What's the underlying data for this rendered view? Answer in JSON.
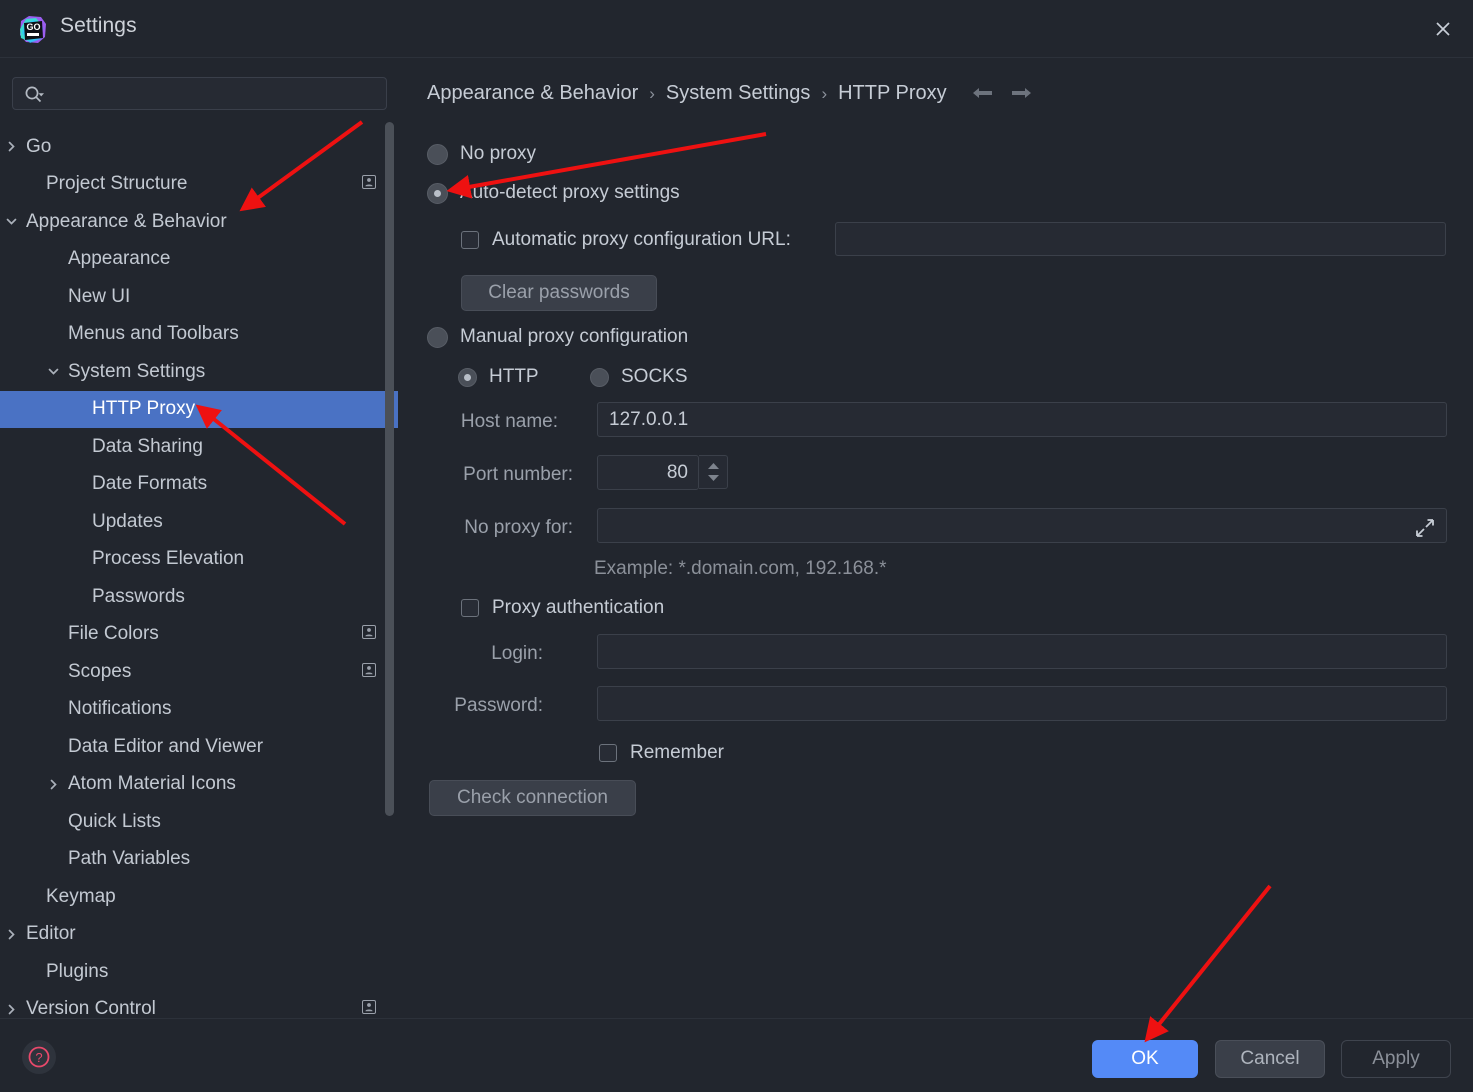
{
  "window": {
    "title": "Settings",
    "logo_icon": "goland-logo-icon",
    "close_icon": "close-icon"
  },
  "sidebar": {
    "search": {
      "placeholder": "",
      "value": "",
      "icon": "search-icon"
    },
    "items": [
      {
        "label": "Go",
        "indent": 26,
        "arrow": "right",
        "badge": false,
        "selected": false
      },
      {
        "label": "Project Structure",
        "indent": 46,
        "arrow": "none",
        "badge": true,
        "selected": false
      },
      {
        "label": "Appearance & Behavior",
        "indent": 26,
        "arrow": "down",
        "badge": false,
        "selected": false
      },
      {
        "label": "Appearance",
        "indent": 68,
        "arrow": "none",
        "badge": false,
        "selected": false
      },
      {
        "label": "New UI",
        "indent": 68,
        "arrow": "none",
        "badge": false,
        "selected": false
      },
      {
        "label": "Menus and Toolbars",
        "indent": 68,
        "arrow": "none",
        "badge": false,
        "selected": false
      },
      {
        "label": "System Settings",
        "indent": 68,
        "arrow": "down",
        "badge": false,
        "selected": false
      },
      {
        "label": "HTTP Proxy",
        "indent": 92,
        "arrow": "none",
        "badge": false,
        "selected": true
      },
      {
        "label": "Data Sharing",
        "indent": 92,
        "arrow": "none",
        "badge": false,
        "selected": false
      },
      {
        "label": "Date Formats",
        "indent": 92,
        "arrow": "none",
        "badge": false,
        "selected": false
      },
      {
        "label": "Updates",
        "indent": 92,
        "arrow": "none",
        "badge": false,
        "selected": false
      },
      {
        "label": "Process Elevation",
        "indent": 92,
        "arrow": "none",
        "badge": false,
        "selected": false
      },
      {
        "label": "Passwords",
        "indent": 92,
        "arrow": "none",
        "badge": false,
        "selected": false
      },
      {
        "label": "File Colors",
        "indent": 68,
        "arrow": "none",
        "badge": true,
        "selected": false
      },
      {
        "label": "Scopes",
        "indent": 68,
        "arrow": "none",
        "badge": true,
        "selected": false
      },
      {
        "label": "Notifications",
        "indent": 68,
        "arrow": "none",
        "badge": false,
        "selected": false
      },
      {
        "label": "Data Editor and Viewer",
        "indent": 68,
        "arrow": "none",
        "badge": false,
        "selected": false
      },
      {
        "label": "Atom Material Icons",
        "indent": 68,
        "arrow": "right",
        "badge": false,
        "selected": false
      },
      {
        "label": "Quick Lists",
        "indent": 68,
        "arrow": "none",
        "badge": false,
        "selected": false
      },
      {
        "label": "Path Variables",
        "indent": 68,
        "arrow": "none",
        "badge": false,
        "selected": false
      },
      {
        "label": "Keymap",
        "indent": 46,
        "arrow": "none",
        "badge": false,
        "selected": false
      },
      {
        "label": "Editor",
        "indent": 26,
        "arrow": "right",
        "badge": false,
        "selected": false
      },
      {
        "label": "Plugins",
        "indent": 46,
        "arrow": "none",
        "badge": false,
        "selected": false
      },
      {
        "label": "Version Control",
        "indent": 26,
        "arrow": "right",
        "badge": true,
        "selected": false
      }
    ]
  },
  "breadcrumb": {
    "parts": [
      "Appearance & Behavior",
      "System Settings",
      "HTTP Proxy"
    ],
    "separator": "›",
    "back_icon": "arrow-left-icon",
    "forward_icon": "arrow-right-icon"
  },
  "main": {
    "no_proxy_label": "No proxy",
    "no_proxy_selected": false,
    "auto_detect_label": "Auto-detect proxy settings",
    "auto_detect_selected": true,
    "pac_url_label": "Automatic proxy configuration URL:",
    "pac_url_checked": false,
    "pac_url_value": "",
    "clear_passwords_label": "Clear passwords",
    "manual_label": "Manual proxy configuration",
    "manual_selected": false,
    "http_label": "HTTP",
    "http_selected": true,
    "socks_label": "SOCKS",
    "socks_selected": false,
    "host_label": "Host name:",
    "host_value": "127.0.0.1",
    "port_label": "Port number:",
    "port_value": "80",
    "no_proxy_for_label": "No proxy for:",
    "no_proxy_for_value": "",
    "example_hint": "Example: *.domain.com, 192.168.*",
    "proxy_auth_label": "Proxy authentication",
    "proxy_auth_checked": false,
    "login_label": "Login:",
    "login_value": "",
    "password_label": "Password:",
    "password_value": "",
    "remember_label": "Remember",
    "remember_checked": false,
    "check_connection_label": "Check connection",
    "expand_icon": "expand-icon",
    "spinner_icon": "spinner-up-down-icon"
  },
  "footer": {
    "help_icon": "help-question-icon",
    "ok_label": "OK",
    "cancel_label": "Cancel",
    "apply_label": "Apply"
  },
  "colors": {
    "accent": "#548af7",
    "selection": "#4a72c4",
    "background": "#22262e",
    "annotation": "#ee1111"
  }
}
